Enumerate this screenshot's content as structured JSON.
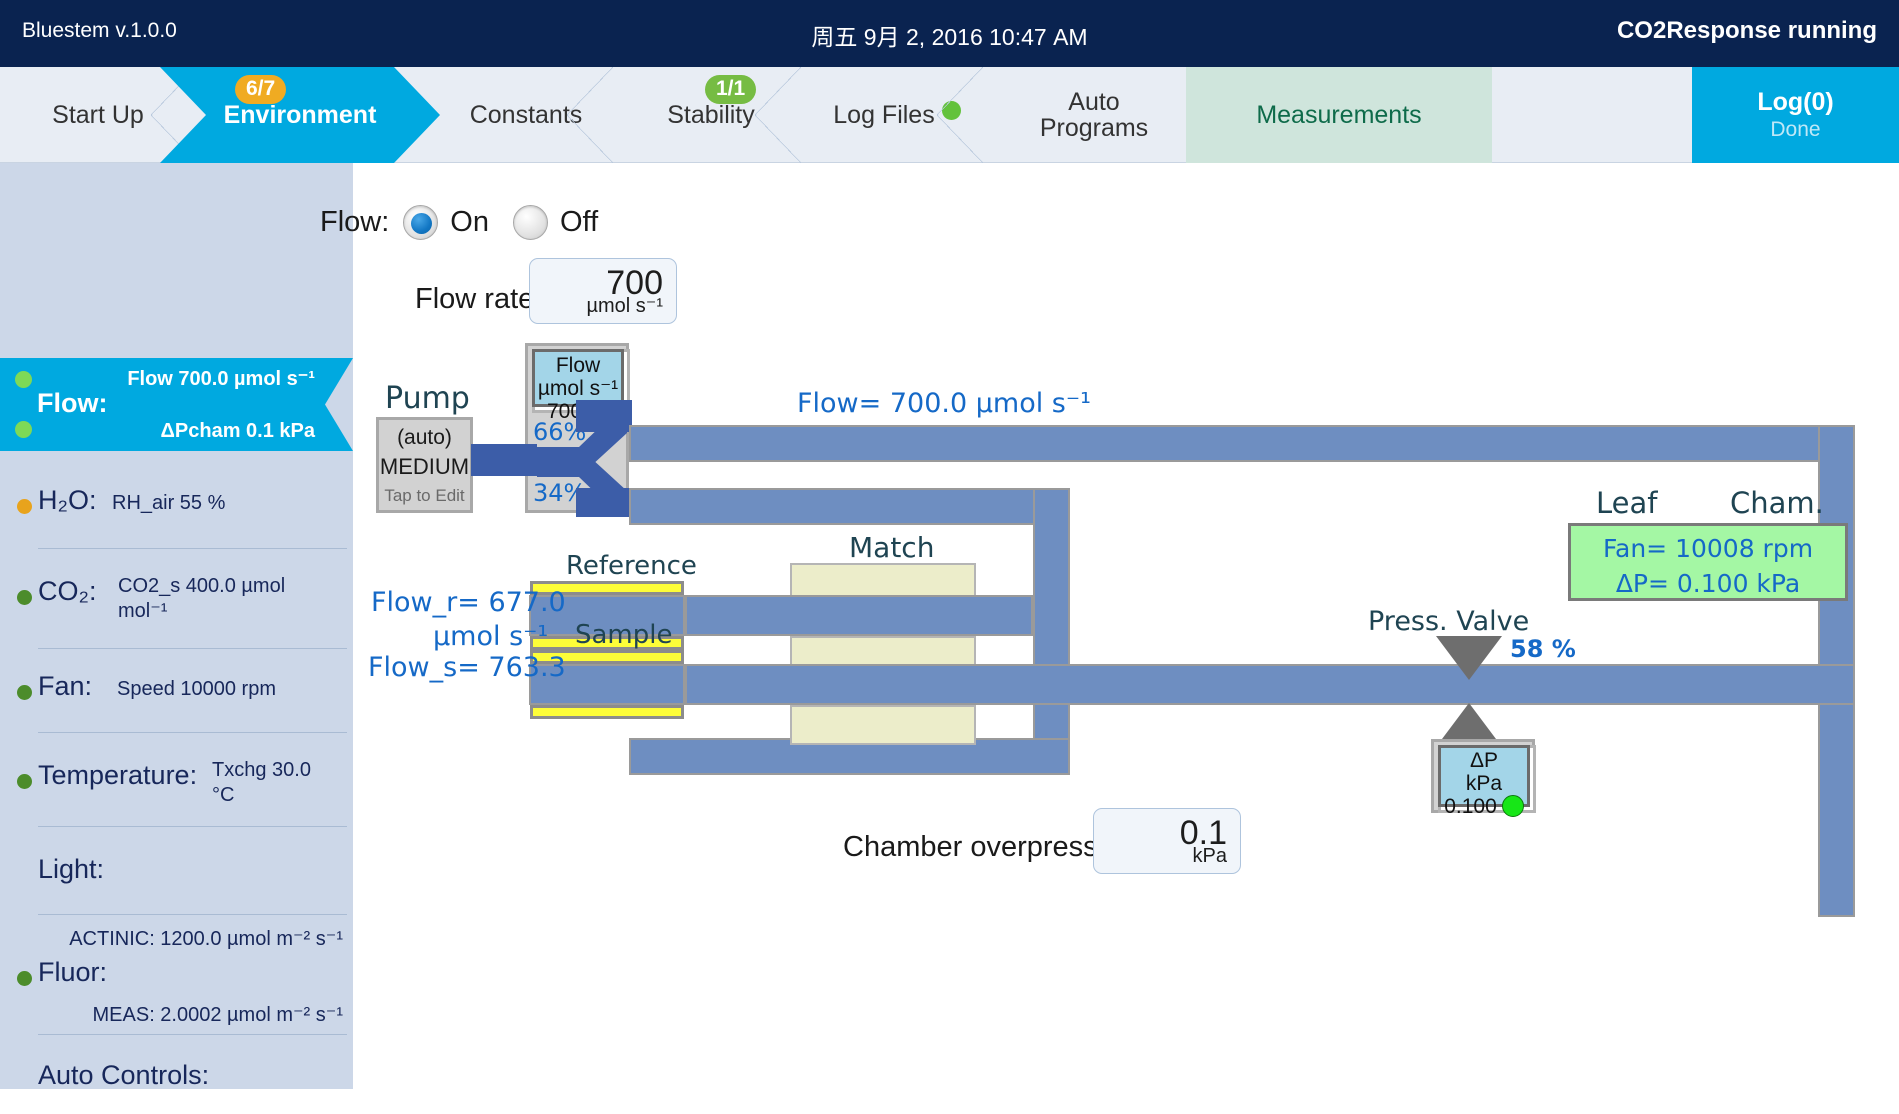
{
  "titlebar": {
    "app": "Bluestem v.1.0.0",
    "datetime": "周五 9月 2, 2016 10:47 AM",
    "status": "CO2Response running"
  },
  "tabs": [
    {
      "label": "Start Up",
      "badge": null,
      "badge_color": null
    },
    {
      "label": "Environment",
      "badge": "6/7",
      "badge_color": "#f0ab22"
    },
    {
      "label": "Constants",
      "badge": null,
      "badge_color": null
    },
    {
      "label": "Stability",
      "badge": "1/1",
      "badge_color": "#76bc43"
    },
    {
      "label": "Log Files",
      "badge": null,
      "badge_color": null
    },
    {
      "label": "Auto",
      "label2": "Programs",
      "badge": null,
      "badge_color": null
    },
    {
      "label": "Measurements",
      "badge": null,
      "badge_color": null
    },
    {
      "label": "Log(0)",
      "sub": "Done",
      "badge": null,
      "badge_color": null
    }
  ],
  "sidebar": {
    "flow": {
      "title": "Flow:",
      "top_value": "Flow 700.0 µmol s⁻¹",
      "bottom_value": "ΔPcham 0.1 kPa"
    },
    "items": [
      {
        "label": "H₂O:",
        "value": "RH_air 55 %",
        "dot": "#e8a31c"
      },
      {
        "label": "CO₂:",
        "value": "CO2_s 400.0 µmol mol⁻¹",
        "dot": "#4c8c2b"
      },
      {
        "label": "Fan:",
        "value": "Speed 10000 rpm",
        "dot": "#4c8c2b"
      },
      {
        "label": "Temperature:",
        "value": "Txchg 30.0 °C",
        "dot": "#4c8c2b"
      },
      {
        "label": "Light:",
        "value": "",
        "dot": null
      },
      {
        "label": "Fluor:",
        "value": "",
        "dot": "#4c8c2b",
        "above": "ACTINIC: 1200.0 µmol m⁻² s⁻¹",
        "below": "MEAS: 2.0002 µmol m⁻² s⁻¹"
      },
      {
        "label": "Auto Controls:",
        "value": "",
        "dot": null
      }
    ]
  },
  "main": {
    "flow_toggle": {
      "label": "Flow:",
      "on_label": "On",
      "off_label": "Off",
      "selected": "On"
    },
    "flow_rate": {
      "label": "Flow rate:",
      "value": "700",
      "unit": "µmol s⁻¹"
    },
    "chamber_overpressure": {
      "label": "Chamber overpressure:",
      "value": "0.1",
      "unit": "kPa"
    },
    "diagram": {
      "pump_title": "Pump",
      "pump_mode": "(auto)",
      "pump_speed": "MEDIUM",
      "pump_hint": "Tap to Edit",
      "flow_lcd": {
        "line1": "Flow",
        "line2": "µmol s⁻¹",
        "value": "700"
      },
      "split_top": "66%",
      "split_bottom": "34%",
      "flow_total": "Flow= 700.0 µmol s⁻¹",
      "flow_r": "Flow_r= 677.0",
      "flow_unit": "µmol s⁻¹",
      "flow_s": "Flow_s= 763.3",
      "reference_label": "Reference",
      "sample_label": "Sample",
      "match_label": "Match",
      "leaf_label": "Leaf",
      "cham_label": "Cham.",
      "leaf_fan": "Fan= 10008 rpm",
      "leaf_dp": "ΔP= 0.100 kPa",
      "valve_label": "Press. Valve",
      "valve_pct": "58 %",
      "dp_lcd": {
        "line1": "ΔP",
        "line2": "kPa",
        "value": "0.100"
      }
    }
  }
}
